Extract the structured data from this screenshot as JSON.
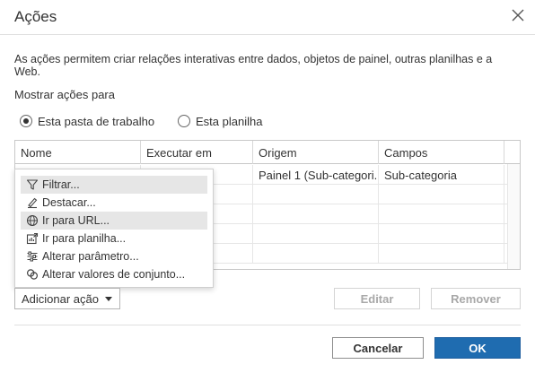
{
  "dialog": {
    "title": "Ações",
    "description": "As ações permitem criar relações interativas entre dados, objetos de painel, outras planilhas e a Web.",
    "show_actions_label": "Mostrar ações para",
    "radio_options": [
      {
        "label": "Esta pasta de trabalho",
        "checked": true
      },
      {
        "label": "Esta planilha",
        "checked": false
      }
    ]
  },
  "table": {
    "columns": [
      "Nome",
      "Executar em",
      "Origem",
      "Campos"
    ],
    "rows": [
      [
        "",
        "",
        "Painel 1 (Sub-categori...",
        "Sub-categoria"
      ]
    ]
  },
  "add_menu": {
    "items": [
      {
        "label": "Filtrar...",
        "icon": "filter-icon",
        "highlighted": true
      },
      {
        "label": "Destacar...",
        "icon": "highlighter-icon",
        "highlighted": false
      },
      {
        "label": "Ir para URL...",
        "icon": "globe-icon",
        "highlighted": true
      },
      {
        "label": "Ir para planilha...",
        "icon": "go-to-sheet-icon",
        "highlighted": false
      },
      {
        "label": "Alterar parâmetro...",
        "icon": "sliders-icon",
        "highlighted": false
      },
      {
        "label": "Alterar valores de conjunto...",
        "icon": "set-values-icon",
        "highlighted": false
      }
    ]
  },
  "buttons": {
    "add_action": "Adicionar ação",
    "edit": "Editar",
    "remove": "Remover",
    "cancel": "Cancelar",
    "ok": "OK"
  },
  "colors": {
    "primary": "#1f6cb0",
    "menu_highlight": "#e6e6e6",
    "disabled_text": "#a8a8a8"
  }
}
